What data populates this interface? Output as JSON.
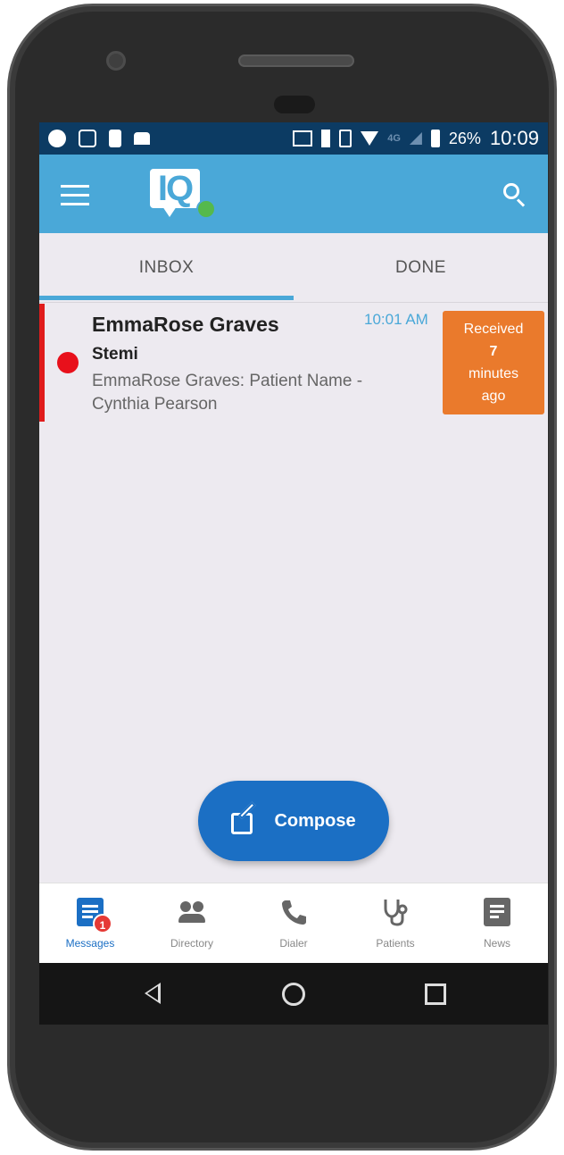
{
  "statusbar": {
    "network": "4G",
    "battery": "26%",
    "time": "10:09"
  },
  "appbar": {
    "logo_text": "IQ"
  },
  "tabs": [
    {
      "label": "INBOX",
      "active": true
    },
    {
      "label": "DONE",
      "active": false
    }
  ],
  "message": {
    "sender": "EmmaRose Graves",
    "subject": "Stemi",
    "preview": "EmmaRose Graves: Patient Name - Cynthia Pearson",
    "time": "10:01 AM",
    "badge_line1": "Received",
    "badge_line2": "7",
    "badge_line3": "minutes",
    "badge_line4": "ago",
    "priority_color": "#e8101b"
  },
  "compose": {
    "label": "Compose"
  },
  "bottom_nav": [
    {
      "label": "Messages",
      "icon": "messages-icon",
      "active": true,
      "badge": "1"
    },
    {
      "label": "Directory",
      "icon": "people-icon",
      "active": false
    },
    {
      "label": "Dialer",
      "icon": "phone-icon",
      "active": false
    },
    {
      "label": "Patients",
      "icon": "stethoscope-icon",
      "active": false
    },
    {
      "label": "News",
      "icon": "news-icon",
      "active": false
    }
  ],
  "colors": {
    "appbar": "#4aa8d8",
    "accent": "#1b6fc4",
    "badge_orange": "#ea7a2c",
    "status_bar": "#0c3b63"
  }
}
